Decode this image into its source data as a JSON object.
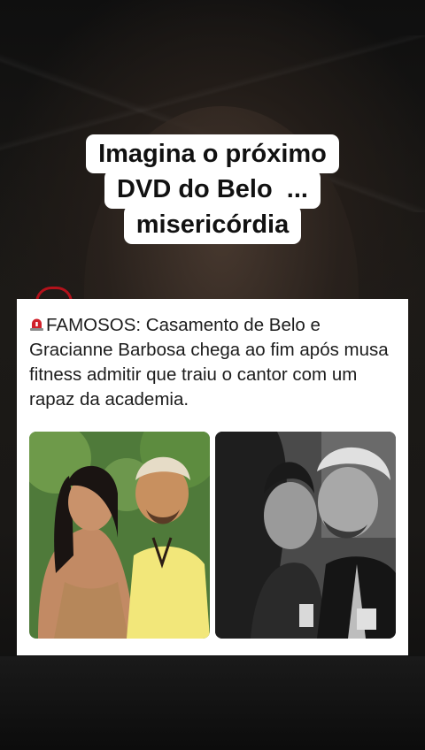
{
  "caption": {
    "lines": [
      "Imagina o próximo",
      "DVD do Belo  ...",
      "misericórdia"
    ]
  },
  "post": {
    "headline": "FAMOSOS: Casamento de Belo e Gracianne Barbosa chega ao fim após musa fitness admitir que traiu o cantor com um rapaz da academia.",
    "siren_icon": "siren-emoji",
    "photos": [
      {
        "name": "couple-color-photo"
      },
      {
        "name": "couple-kiss-bw-photo"
      }
    ]
  },
  "colors": {
    "caption_bg": "#ffffff",
    "card_bg": "#ffffff",
    "text": "#1c1c1c",
    "siren_red": "#d0202a"
  }
}
